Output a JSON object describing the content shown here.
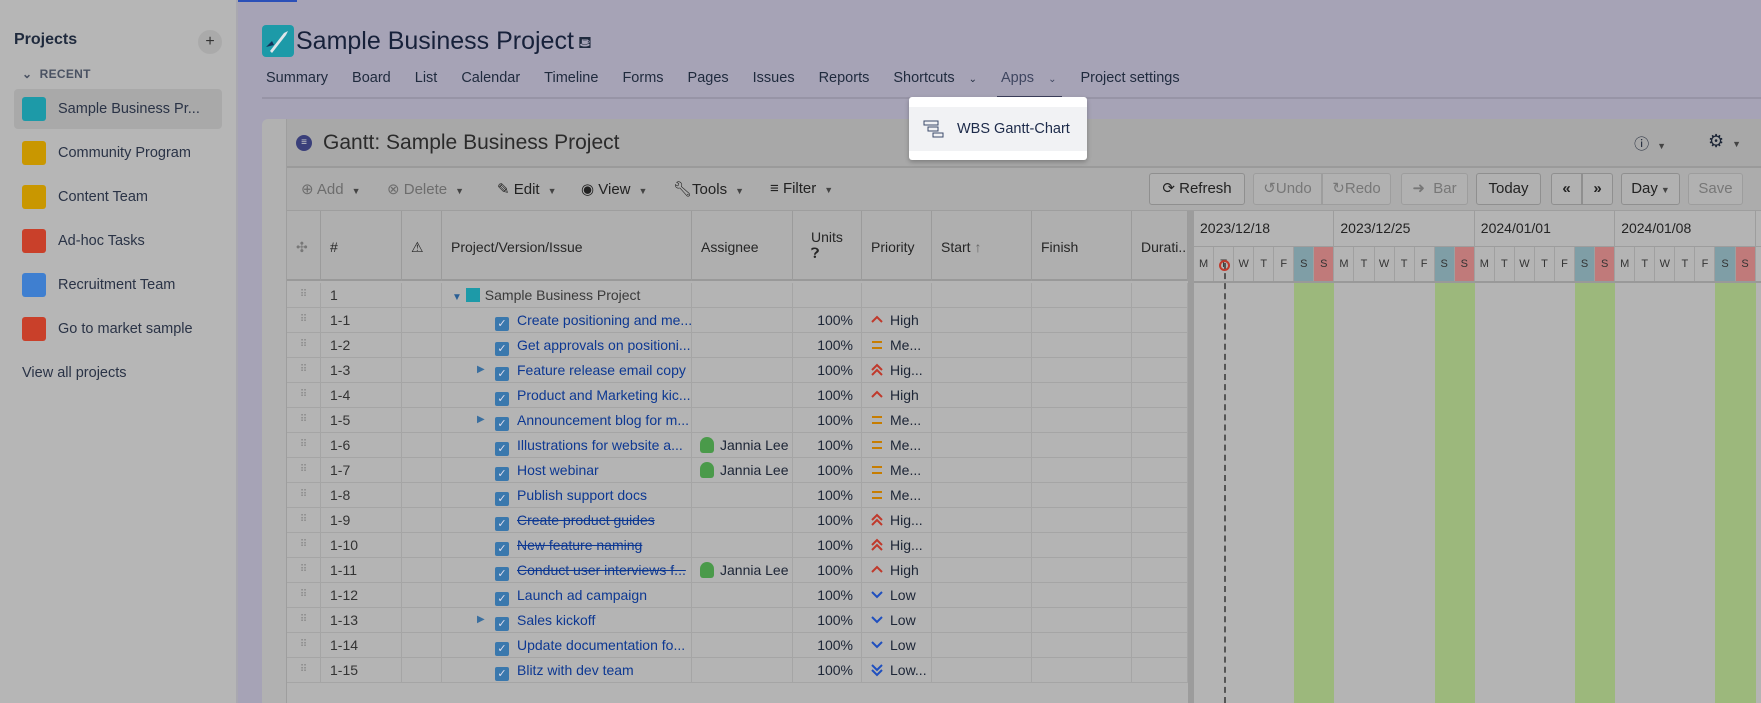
{
  "sidebar": {
    "title": "Projects",
    "add_label": "+",
    "recent_label": "RECENT",
    "view_all": "View all projects",
    "items": [
      {
        "label": "Sample Business Pr...",
        "icon": "rocket-icon",
        "color": "#1d9aa8"
      },
      {
        "label": "Community Program",
        "icon": "easel-icon",
        "color": "#c99700"
      },
      {
        "label": "Content Team",
        "icon": "easel-icon",
        "color": "#c99700"
      },
      {
        "label": "Ad-hoc Tasks",
        "icon": "sliders-icon",
        "color": "#c9402a"
      },
      {
        "label": "Recruitment Team",
        "icon": "mountain-icon",
        "color": "#3f7fd0"
      },
      {
        "label": "Go to market sample",
        "icon": "wrench-icon",
        "color": "#c9402a"
      }
    ]
  },
  "header": {
    "title": "Sample Business Project",
    "tabs": [
      "Summary",
      "Board",
      "List",
      "Calendar",
      "Timeline",
      "Forms",
      "Pages",
      "Issues",
      "Reports",
      "Shortcuts",
      "Apps",
      "Project settings"
    ],
    "active_tab": "Apps"
  },
  "apps_menu": {
    "items": [
      "WBS Gantt-Chart"
    ]
  },
  "gantt": {
    "title": "Gantt:  Sample Business Project",
    "toolbar": {
      "add": "Add",
      "delete": "Delete",
      "edit": "Edit",
      "view": "View",
      "tools": "Tools",
      "filter": "Filter",
      "refresh": "Refresh",
      "undo": "Undo",
      "redo": "Redo",
      "bar": "Bar",
      "today": "Today",
      "prev": "«",
      "next": "»",
      "scale": "Day",
      "save": "Save"
    },
    "columns": {
      "num": "#",
      "name": "Project/Version/Issue",
      "assignee": "Assignee",
      "units": "Units",
      "priority": "Priority",
      "start": "Start",
      "finish": "Finish",
      "duration": "Durati.."
    },
    "weeks": [
      "2023/12/18",
      "2023/12/25",
      "2024/01/01",
      "2024/01/08"
    ],
    "days": [
      "M",
      "T",
      "W",
      "T",
      "F",
      "S",
      "S"
    ],
    "today": "2023/12/19",
    "colors": {
      "saturday": "#7f9ea6",
      "sunday": "#c07a7a",
      "weekend_column": "#9cb87c",
      "link": "#0d3892"
    },
    "rows": [
      {
        "num": "1",
        "name": "Sample Business Project",
        "project": true
      },
      {
        "num": "1-1",
        "name": "Create positioning and me...",
        "units": "100%",
        "priority": "High",
        "level": "high"
      },
      {
        "num": "1-2",
        "name": "Get approvals on positioni...",
        "units": "100%",
        "priority": "Me...",
        "level": "medium"
      },
      {
        "num": "1-3",
        "name": "Feature release email copy",
        "units": "100%",
        "priority": "Hig...",
        "level": "highest",
        "expand": true
      },
      {
        "num": "1-4",
        "name": "Product and Marketing kic...",
        "units": "100%",
        "priority": "High",
        "level": "high"
      },
      {
        "num": "1-5",
        "name": "Announcement blog for m...",
        "units": "100%",
        "priority": "Me...",
        "level": "medium",
        "expand": true
      },
      {
        "num": "1-6",
        "name": "Illustrations for website a...",
        "assignee": "Jannia Lee",
        "units": "100%",
        "priority": "Me...",
        "level": "medium"
      },
      {
        "num": "1-7",
        "name": "Host webinar",
        "assignee": "Jannia Lee",
        "units": "100%",
        "priority": "Me...",
        "level": "medium"
      },
      {
        "num": "1-8",
        "name": "Publish support docs",
        "units": "100%",
        "priority": "Me...",
        "level": "medium"
      },
      {
        "num": "1-9",
        "name": "Create product guides",
        "units": "100%",
        "priority": "Hig...",
        "level": "highest",
        "done": true
      },
      {
        "num": "1-10",
        "name": "New feature naming",
        "units": "100%",
        "priority": "Hig...",
        "level": "highest",
        "done": true
      },
      {
        "num": "1-11",
        "name": "Conduct user interviews f...",
        "assignee": "Jannia Lee",
        "units": "100%",
        "priority": "High",
        "level": "high",
        "done": true
      },
      {
        "num": "1-12",
        "name": "Launch ad campaign",
        "units": "100%",
        "priority": "Low",
        "level": "low"
      },
      {
        "num": "1-13",
        "name": "Sales kickoff",
        "units": "100%",
        "priority": "Low",
        "level": "low",
        "expand": true
      },
      {
        "num": "1-14",
        "name": "Update documentation fo...",
        "units": "100%",
        "priority": "Low",
        "level": "low"
      },
      {
        "num": "1-15",
        "name": "Blitz with dev team",
        "units": "100%",
        "priority": "Low...",
        "level": "lowest"
      }
    ]
  }
}
